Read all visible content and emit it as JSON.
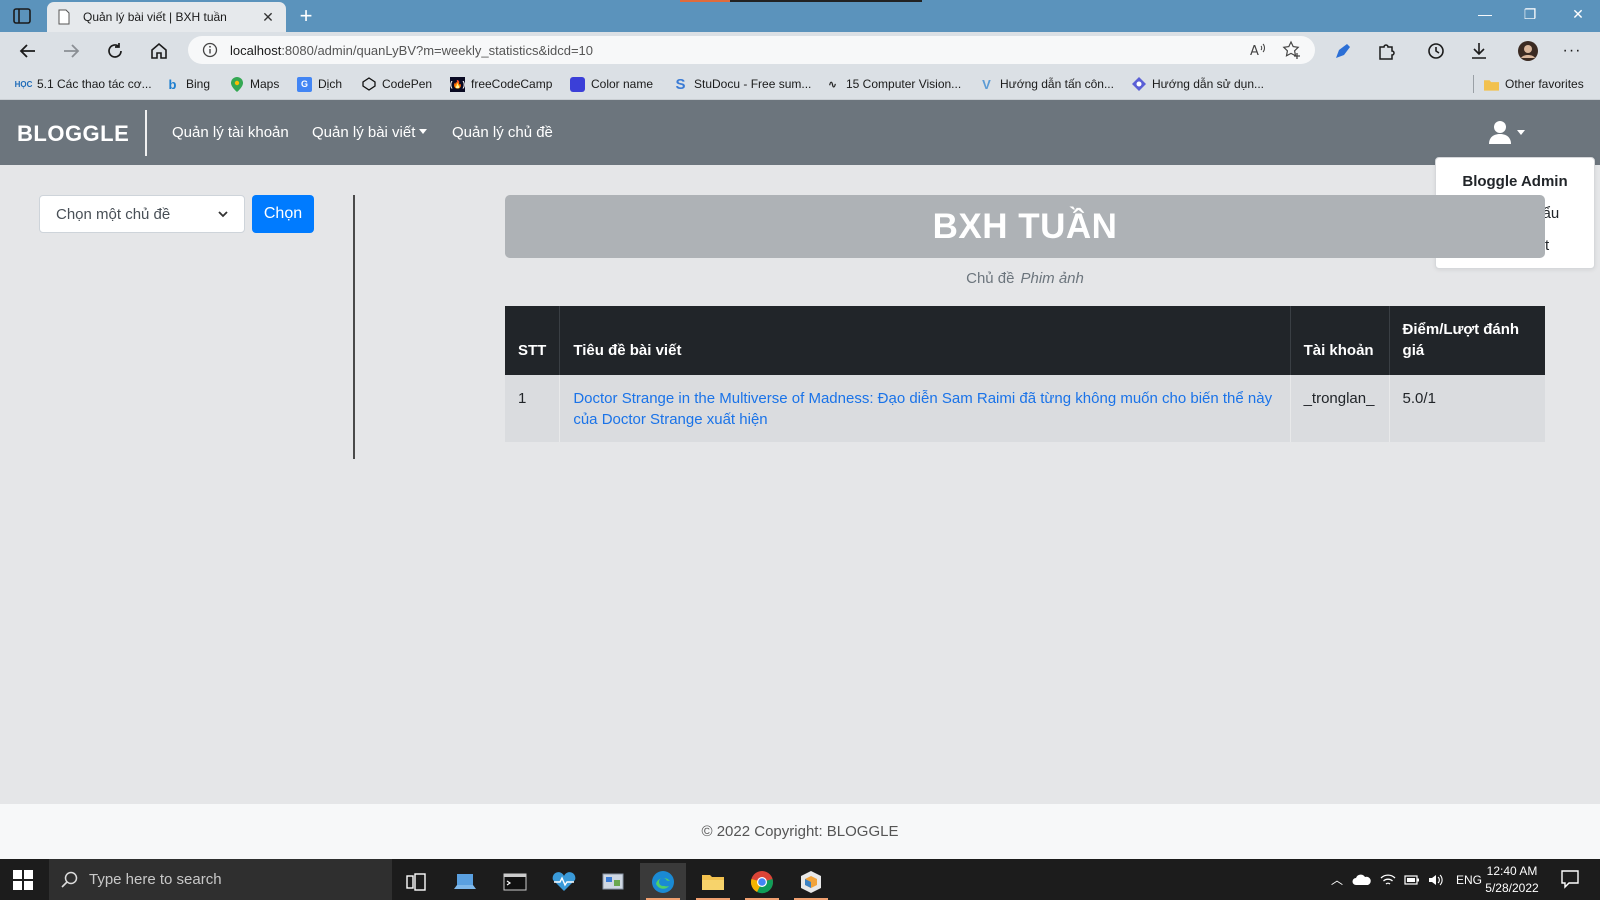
{
  "browser": {
    "tab_title": "Quản lý bài viết | BXH tuần",
    "url_host": "localhost",
    "url_rest": ":8080/admin/quanLyBV?m=weekly_statistics&idcd=10",
    "favorites": [
      {
        "label": "5.1 Các thao tác cơ...",
        "icon": "hoc-icon",
        "color": "#1e6bb8"
      },
      {
        "label": "Bing",
        "icon": "bing-icon",
        "color": "#1e7fd0"
      },
      {
        "label": "Maps",
        "icon": "maps-icon",
        "color": "#e94235"
      },
      {
        "label": "Dịch",
        "icon": "translate-icon",
        "color": "#4285f4"
      },
      {
        "label": "CodePen",
        "icon": "codepen-icon",
        "color": "#111111"
      },
      {
        "label": "freeCodeCamp",
        "icon": "freecodecamp-icon",
        "color": "#0a0a23"
      },
      {
        "label": "Color name",
        "icon": "colorname-icon",
        "color": "#3b3fd8"
      },
      {
        "label": "StuDocu - Free sum...",
        "icon": "studocu-icon",
        "color": "#3a7bd5"
      },
      {
        "label": "15 Computer Vision...",
        "icon": "cv-icon",
        "color": "#222222"
      },
      {
        "label": "Hướng dẫn tấn côn...",
        "icon": "v-icon",
        "color": "#5b9bd5"
      },
      {
        "label": "Hướng dẫn sử dụn...",
        "icon": "guide-icon",
        "color": "#5a5fd6"
      }
    ],
    "other_favorites": "Other favorites"
  },
  "site": {
    "brand": "BLOGGLE",
    "nav": {
      "accounts": "Quản lý tài khoản",
      "posts": "Quản lý bài viết",
      "topics": "Quản lý chủ đề"
    },
    "user_menu": {
      "name": "Bloggle Admin",
      "change_password": "Đổi mật khẩu",
      "logout": "Đăng xuất"
    }
  },
  "filter": {
    "select_value": "Chọn một chủ đề",
    "button": "Chọn"
  },
  "main": {
    "heading": "BXH TUẦN",
    "topic_label": "Chủ đề",
    "topic_value": "Phim ảnh",
    "table": {
      "headers": [
        "STT",
        "Tiêu đề bài viết",
        "Tài khoản",
        "Điểm/Lượt đánh giá"
      ],
      "rows": [
        {
          "stt": "1",
          "title": "Doctor Strange in the Multiverse of Madness: Đạo diễn Sam Raimi đã từng không muốn cho biến thể này của Doctor Strange xuất hiện",
          "account": "_tronglan_",
          "score": "5.0/1"
        }
      ]
    }
  },
  "footer": {
    "copyright": "© 2022 Copyright: BLOGGLE"
  },
  "taskbar": {
    "search_placeholder": "Type here to search",
    "language": "ENG",
    "time": "12:40 AM",
    "date": "5/28/2022"
  },
  "colors": {
    "navbar": "#6c757d",
    "primary": "#007bff",
    "table_header": "#212529",
    "link": "#1a73e8"
  }
}
